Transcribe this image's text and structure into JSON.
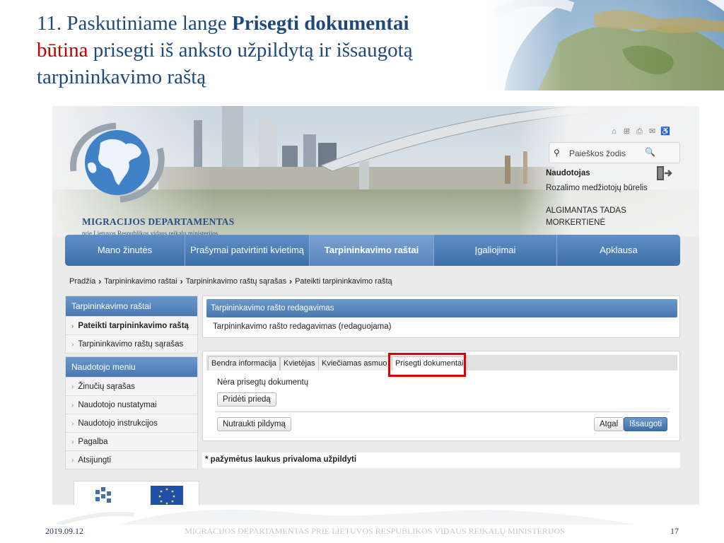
{
  "slide": {
    "title_prefix": "11. Paskutiniame lange ",
    "title_bold": "Prisegti dokumentai",
    "title_red": "būtina",
    "title_rest": " prisegti iš anksto užpildytą ir išsaugotą tarpininkavimo raštą",
    "footer_date": "2019.09.12",
    "footer_org": "MIGRACIJOS DEPARTAMENTAS PRIE LIETUVOS RESPUBLIKOS VIDAUS REIKALŲ MINISTERIJOS",
    "page_number": "17"
  },
  "header": {
    "logo_title": "MIGRACIJOS DEPARTAMENTAS",
    "logo_subtitle": "prie Lietuvos Respublikos vidaus reikalų ministerijos",
    "top_icons": [
      "home-icon",
      "sitemap-icon",
      "print-icon",
      "mail-icon",
      "accessibility-icon"
    ],
    "search": {
      "placeholder": "Paieškos žodis"
    },
    "user": {
      "heading": "Naudotojas",
      "group": "Rozalimo medžiotojų būrelis",
      "name": "ALGIMANTAS TADAS MORKERTIENĖ"
    }
  },
  "nav": {
    "items": [
      {
        "label": "Mano žinutės"
      },
      {
        "label": "Prašymai patvirtinti kvietimą"
      },
      {
        "label": "Tarpininkavimo raštai"
      },
      {
        "label": "Įgaliojimai"
      },
      {
        "label": "Apklausa"
      }
    ],
    "active_index": 2
  },
  "breadcrumb": [
    "Pradžia",
    "Tarpininkavimo raštai",
    "Tarpininkavimo raštų sąrašas",
    "Pateikti tarpininkavimo raštą"
  ],
  "sidebar": {
    "section1": {
      "title": "Tarpininkavimo raštai",
      "items": [
        "Pateikti tarpininkavimo raštą",
        "Tarpininkavimo raštų sąrašas"
      ]
    },
    "section2": {
      "title": "Naudotojo meniu",
      "items": [
        "Žinučių sąrašas",
        "Naudotojo nustatymai",
        "Naudotojo instrukcijos",
        "Pagalba",
        "Atsijungti"
      ]
    }
  },
  "content": {
    "panel_title": "Tarpininkavimo rašto redagavimas",
    "panel_status": "Tarpininkavimo rašto redagavimas (redaguojama)",
    "tabs": [
      "Bendra informacija",
      "Kvietėjas",
      "Kviečiamas asmuo",
      "Prisegti dokumentai"
    ],
    "active_tab": 3,
    "no_docs": "Nėra prisegtų dokumentų",
    "add_button": "Pridėti priedą",
    "abort_button": "Nutraukti pildymą",
    "back_button": "Atgal",
    "save_button": "Išsaugoti",
    "required_note": "* pažymėtus laukus privaloma užpildyti"
  },
  "colors": {
    "title_blue": "#1f497d",
    "highlight_red": "#e00000",
    "nav_blue": "#4a79b2"
  }
}
